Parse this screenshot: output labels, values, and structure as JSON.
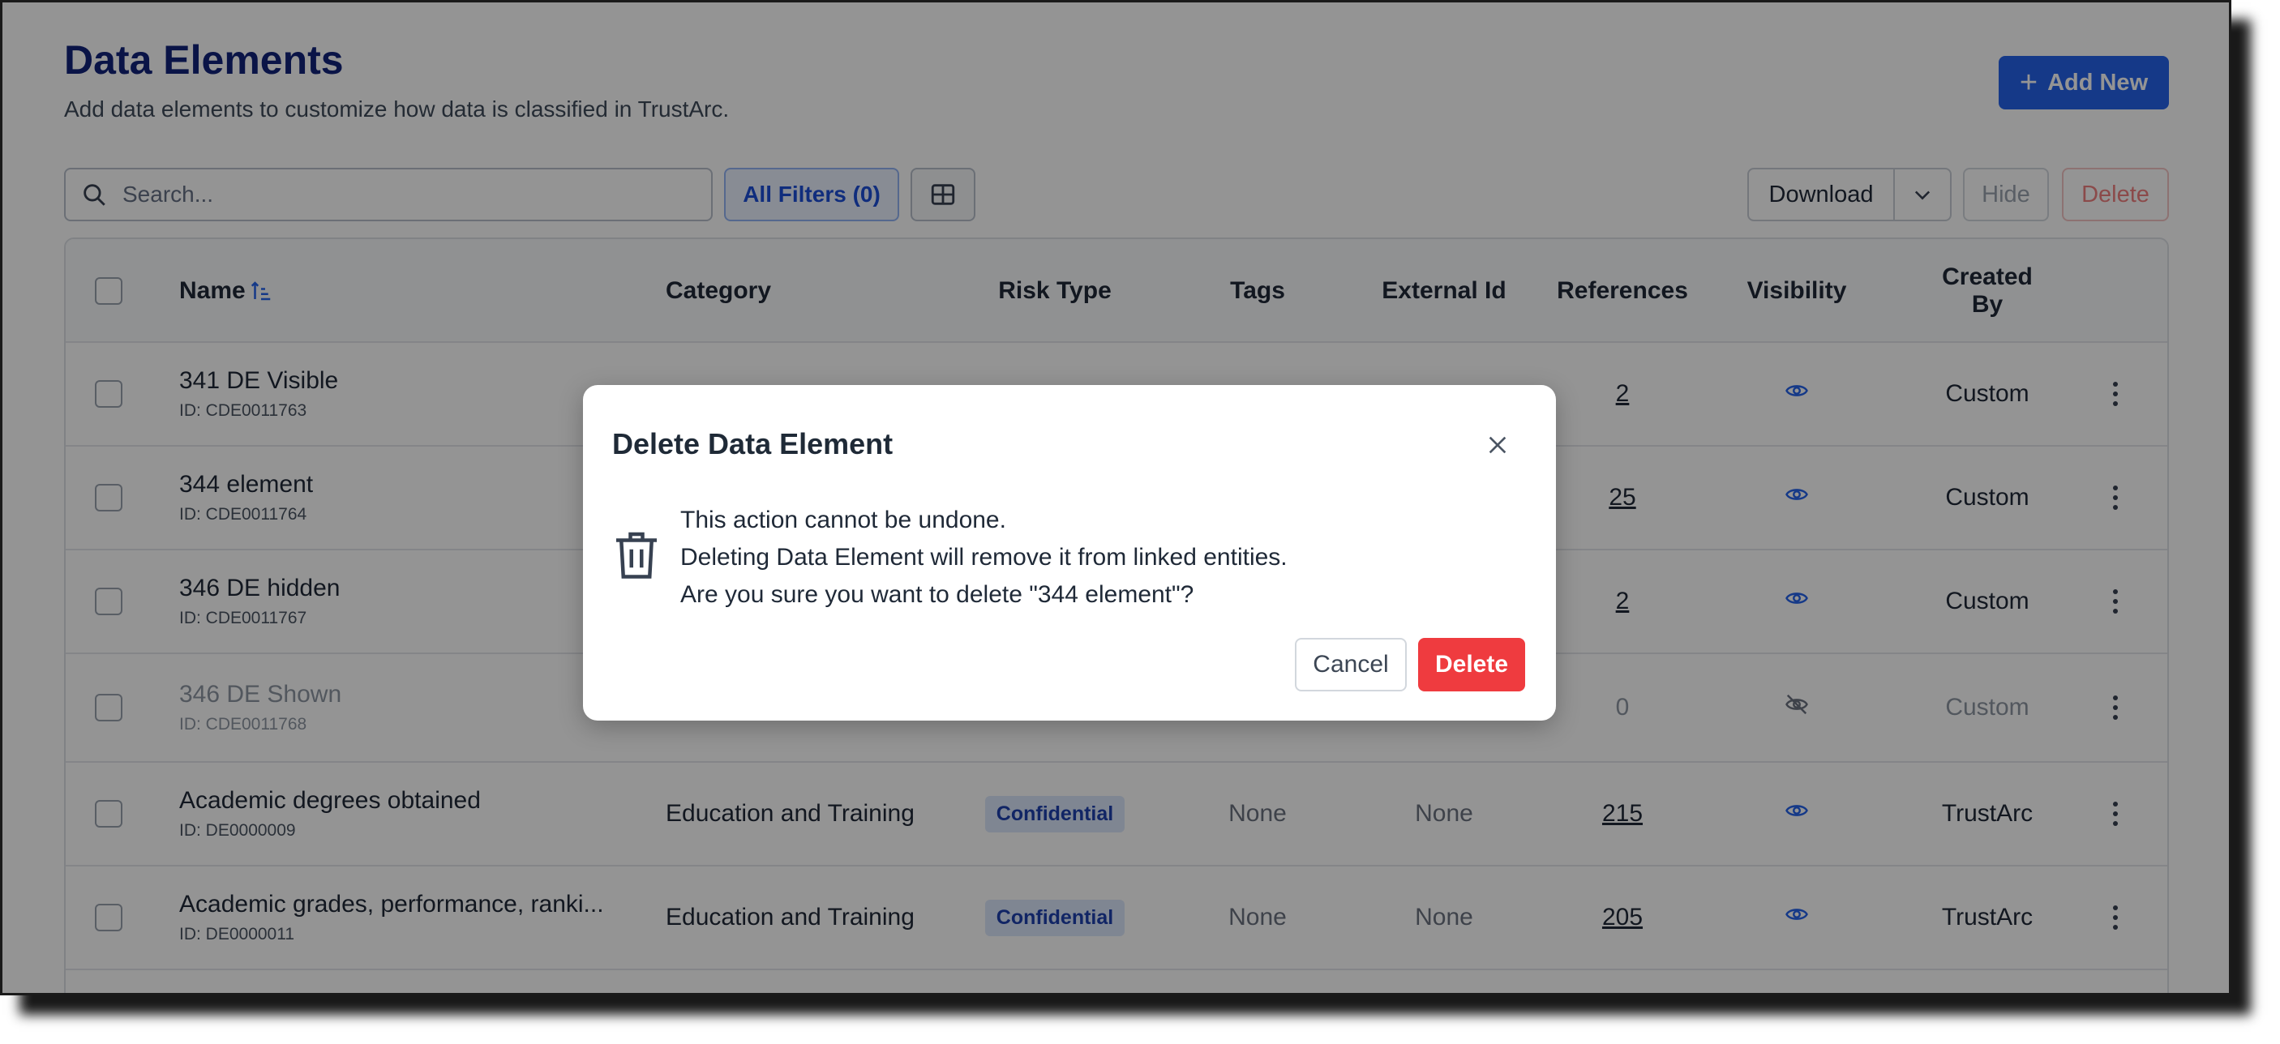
{
  "header": {
    "title": "Data Elements",
    "subtitle": "Add data elements to customize how data is classified in TrustArc.",
    "add_button": "Add New"
  },
  "toolbar": {
    "search_placeholder": "Search...",
    "filters_label": "All Filters (0)",
    "download_label": "Download",
    "hide_label": "Hide",
    "delete_label": "Delete"
  },
  "table": {
    "columns": {
      "name": "Name",
      "category": "Category",
      "risk_type": "Risk Type",
      "tags": "Tags",
      "external_id": "External Id",
      "references": "References",
      "visibility": "Visibility",
      "created_by_line1": "Created",
      "created_by_line2": "By"
    },
    "rows": [
      {
        "name": "341 DE Visible",
        "id": "ID: CDE0011763",
        "category": "",
        "risk": "",
        "tags": "",
        "external_id": "",
        "references": "2",
        "visibility": "visible",
        "created_by": "Custom"
      },
      {
        "name": "344 element",
        "id": "ID: CDE0011764",
        "category": "",
        "risk": "",
        "tags": "",
        "external_id": "",
        "references": "25",
        "visibility": "visible",
        "created_by": "Custom"
      },
      {
        "name": "346 DE hidden",
        "id": "ID: CDE0011767",
        "category": "",
        "risk": "",
        "tags": "",
        "external_id": "",
        "references": "2",
        "visibility": "visible",
        "created_by": "Custom"
      },
      {
        "name": "346 DE Shown",
        "id": "ID: CDE0011768",
        "category": "",
        "risk": "",
        "tags": "",
        "external_id": "",
        "references": "0",
        "visibility": "hidden",
        "created_by": "Custom"
      },
      {
        "name": "Academic degrees obtained",
        "id": "ID: DE0000009",
        "category": "Education and Training",
        "risk": "Confidential",
        "tags": "None",
        "external_id": "None",
        "references": "215",
        "visibility": "visible",
        "created_by": "TrustArc"
      },
      {
        "name": "Academic grades, performance, ranki...",
        "id": "ID: DE0000011",
        "category": "Education and Training",
        "risk": "Confidential",
        "tags": "None",
        "external_id": "None",
        "references": "205",
        "visibility": "visible",
        "created_by": "TrustArc"
      }
    ]
  },
  "modal": {
    "title": "Delete Data Element",
    "line1": "This action cannot be undone.",
    "line2": "Deleting Data Element will remove it from linked entities.",
    "line3": "Are you sure you want to delete \"344 element\"?",
    "cancel_label": "Cancel",
    "confirm_label": "Delete"
  },
  "colors": {
    "primary": "#2563eb",
    "danger": "#ef3b3f",
    "title": "#12237a",
    "badge_bg": "#dbe7fb"
  }
}
